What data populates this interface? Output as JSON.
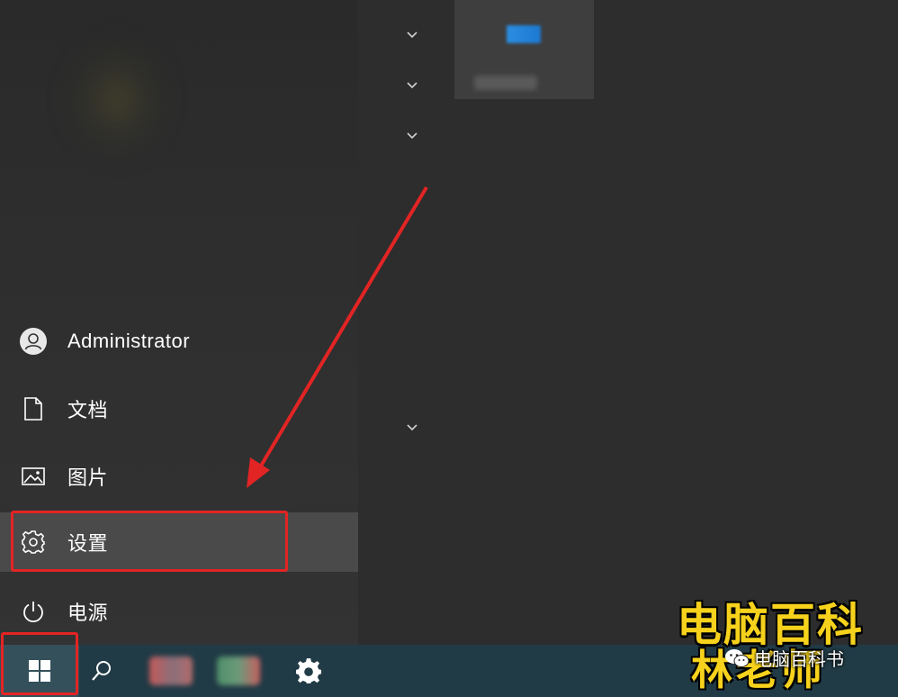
{
  "start_menu": {
    "user": {
      "label": "Administrator",
      "icon": "user-avatar-icon"
    },
    "items": [
      {
        "label": "文档",
        "icon": "document-icon"
      },
      {
        "label": "图片",
        "icon": "pictures-icon"
      },
      {
        "label": "设置",
        "icon": "gear-icon",
        "highlighted": true
      },
      {
        "label": "电源",
        "icon": "power-icon"
      }
    ],
    "group_chevrons": [
      "chevron-down-icon",
      "chevron-down-icon",
      "chevron-down-icon",
      "chevron-down-icon"
    ]
  },
  "taskbar": {
    "buttons": [
      {
        "name": "start",
        "icon": "windows-logo-icon"
      },
      {
        "name": "search",
        "icon": "search-icon"
      },
      {
        "name": "app-1",
        "icon": "blurred-app-icon"
      },
      {
        "name": "app-2",
        "icon": "blurred-app-icon"
      },
      {
        "name": "settings",
        "icon": "gear-icon"
      }
    ]
  },
  "annotation": {
    "color": "#e32424",
    "arrow": "pointing to 设置"
  },
  "watermark": {
    "title": "电脑百科",
    "subtitle": "林老师",
    "wechat_account": "电脑百科书",
    "title_color": "#f6d21c"
  }
}
